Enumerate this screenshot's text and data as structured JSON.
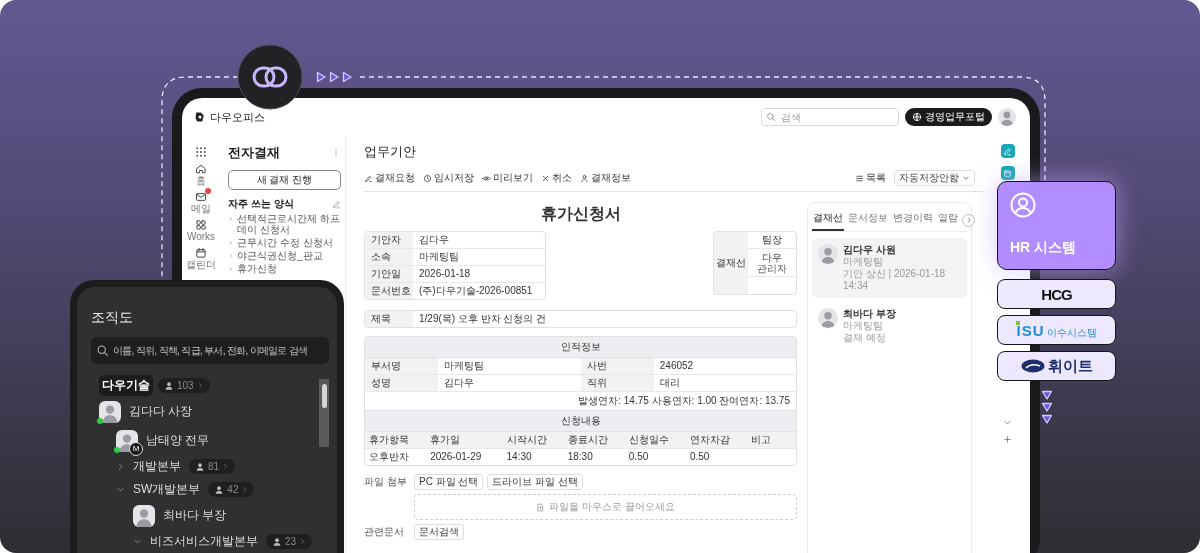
{
  "topbar": {
    "logo": "다우오피스",
    "search": {
      "placeholder": "검색"
    },
    "portal_button": "경영업무포털"
  },
  "nav": [
    {
      "kind": "apps"
    },
    {
      "kind": "home",
      "label": "홈"
    },
    {
      "kind": "mail",
      "label": "메일",
      "unread": true
    },
    {
      "kind": "works",
      "label": "Works"
    },
    {
      "kind": "calendar",
      "label": "캘린더"
    }
  ],
  "sidebar": {
    "title": "전자결재",
    "new_button": "새 결재 진행",
    "favorites_title": "자주 쓰는 양식",
    "forms": [
      "선택적근로시간제 하프데이 신청서",
      "근무시간 수정 신청서",
      "야근식권신청_판교",
      "휴가신청"
    ]
  },
  "main": {
    "title": "업무기안",
    "toolbar": [
      {
        "kind": "request",
        "label": "결재요청"
      },
      {
        "kind": "draft",
        "label": "임시저장"
      },
      {
        "kind": "preview",
        "label": "미리보기"
      },
      {
        "kind": "cancel",
        "label": "취소"
      },
      {
        "kind": "info",
        "label": "결재정보"
      }
    ],
    "list_button": "목록",
    "autosave": "자동저장안함"
  },
  "document": {
    "title": "휴가신청서",
    "info": [
      {
        "label": "기안자",
        "value": "김다우"
      },
      {
        "label": "소속",
        "value": "마케팅팀"
      },
      {
        "label": "기안일",
        "value": "2026-01-18"
      },
      {
        "label": "문서번호",
        "value": "(주)다우기술-2026-00851"
      }
    ],
    "approval": {
      "label": "결재선",
      "role": "팀장",
      "name": "다우",
      "title": "관리자"
    },
    "subject": {
      "label": "제목",
      "value": "1/29(목) 오후 반차 신청의 건"
    },
    "personal": {
      "title": "인적정보",
      "fields": [
        {
          "label": "부서명",
          "value": "마케팅팀"
        },
        {
          "label": "사번",
          "value": "246052"
        },
        {
          "label": "성명",
          "value": "김다우"
        },
        {
          "label": "직위",
          "value": "대리"
        }
      ],
      "summary": "발생연차: 14.75 사용연차: 1.00 잔여연차: 13.75"
    },
    "request": {
      "title": "신청내용",
      "columns": [
        "휴가항목",
        "휴가일",
        "시작시간",
        "종료시간",
        "신청일수",
        "연차차감",
        "비고"
      ],
      "rows": [
        [
          "오후반차",
          "2026-01-29",
          "14:30",
          "18:30",
          "0.50",
          "0.50"
        ]
      ]
    },
    "attachment": {
      "label": "파일 첨부",
      "buttons": [
        "PC 파일 선택",
        "드라이브 파일 선택"
      ],
      "dropzone": "파일을 마우스로 끌어오세요"
    },
    "related": {
      "label": "관련문서",
      "button": "문서검색"
    }
  },
  "approval_panel": {
    "tabs": [
      {
        "label": "결재선",
        "selected": true
      },
      {
        "label": "문서정보",
        "selected": false
      },
      {
        "label": "변경이력",
        "selected": false
      },
      {
        "label": "열람",
        "selected": false
      }
    ],
    "approvers": [
      {
        "name": "김다우 사원",
        "team": "마케팅팀",
        "status": "기안 상신 | 2026-01-18 14:34",
        "selected": true
      },
      {
        "name": "최바다 부장",
        "team": "마케팅팀",
        "status": "결재 예정",
        "selected": false
      }
    ]
  },
  "org_chart": {
    "title": "조직도",
    "search": {
      "placeholder": "이름, 직위, 직책, 직급, 부서, 전화, 이메일로 검색"
    },
    "tree": [
      {
        "kind": "org",
        "name": "다우기술",
        "count": "103",
        "selected": true,
        "children": [
          {
            "kind": "person",
            "name": "김다다 사장",
            "online": true,
            "children": [
              {
                "kind": "person",
                "name": "남태양 전무",
                "online": true,
                "badge": "M"
              },
              {
                "kind": "org",
                "name": "개발본부",
                "count": "81",
                "selected": false,
                "expanded": false
              },
              {
                "kind": "org",
                "name": "SW개발본부",
                "count": "42",
                "selected": false,
                "expanded": true,
                "children": [
                  {
                    "kind": "person",
                    "name": "최바다 부장",
                    "online": false
                  },
                  {
                    "kind": "org",
                    "name": "비즈서비스개발본부",
                    "count": "23",
                    "selected": false,
                    "expanded": true
                  }
                ]
              }
            ]
          }
        ]
      }
    ]
  },
  "systems": [
    {
      "kind": "hr",
      "label": "HR 시스템",
      "selected": true
    },
    {
      "kind": "hcg",
      "label": "HCG",
      "selected": false
    },
    {
      "kind": "isu",
      "label": "ISU",
      "sub": "이수시스템",
      "selected": false
    },
    {
      "kind": "whit",
      "label": "휘이트",
      "selected": false
    }
  ]
}
